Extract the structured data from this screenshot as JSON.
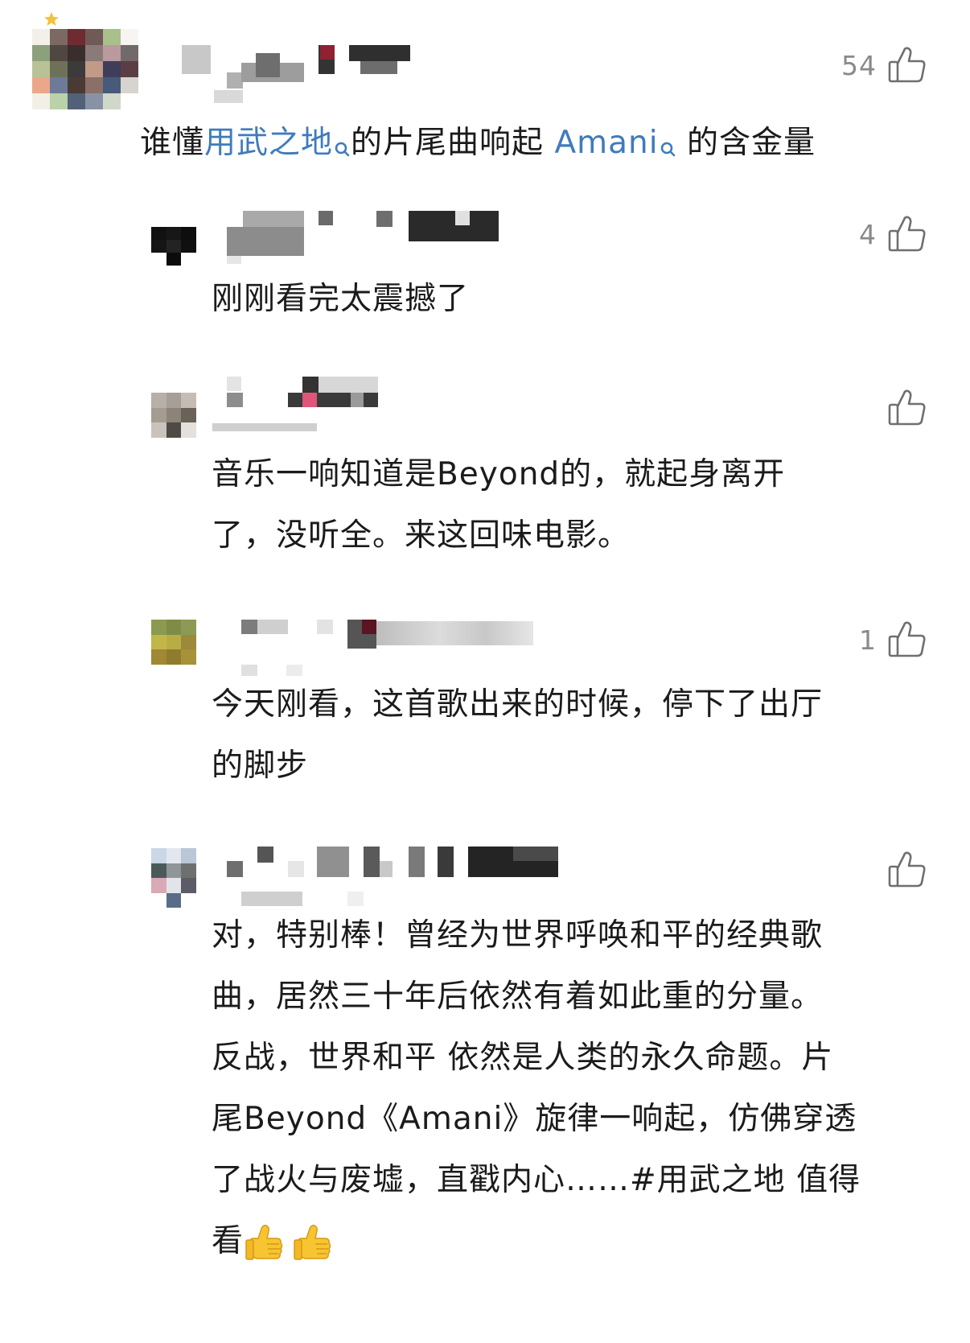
{
  "comments": [
    {
      "likes": "54",
      "text_parts": {
        "p1": "谁懂",
        "link1": "用武之地",
        "p2": "的片尾曲响起 ",
        "link2": "Amani",
        "p3": " 的含金量"
      }
    },
    {
      "likes": "4",
      "lines": [
        "刚刚看完太震撼了"
      ]
    },
    {
      "likes": "",
      "lines": [
        "音乐一响知道是Beyond的，就起身离开",
        "了，没听全。来这回味电影。"
      ]
    },
    {
      "likes": "1",
      "lines": [
        "今天刚看，这首歌出来的时候，停下了出厅",
        "的脚步"
      ]
    },
    {
      "likes": "",
      "lines": [
        "对，特别棒！曾经为世界呼唤和平的经典歌",
        "曲，居然三十年后依然有着如此重的分量。",
        "反战，世界和平 依然是人类的永久命题。片",
        "尾Beyond《Amani》旋律一响起，仿佛穿透",
        "了战火与废墟，直戳内心……#用武之地 值得",
        "看"
      ]
    }
  ],
  "icons": {
    "like": "thumbs-up-outline-icon",
    "search": "search-icon",
    "emoji": "thumbs-up-emoji-icon"
  },
  "colors": {
    "link": "#3f7bbd",
    "like_count": "#8a8a8a",
    "text": "#1b1b1b"
  }
}
